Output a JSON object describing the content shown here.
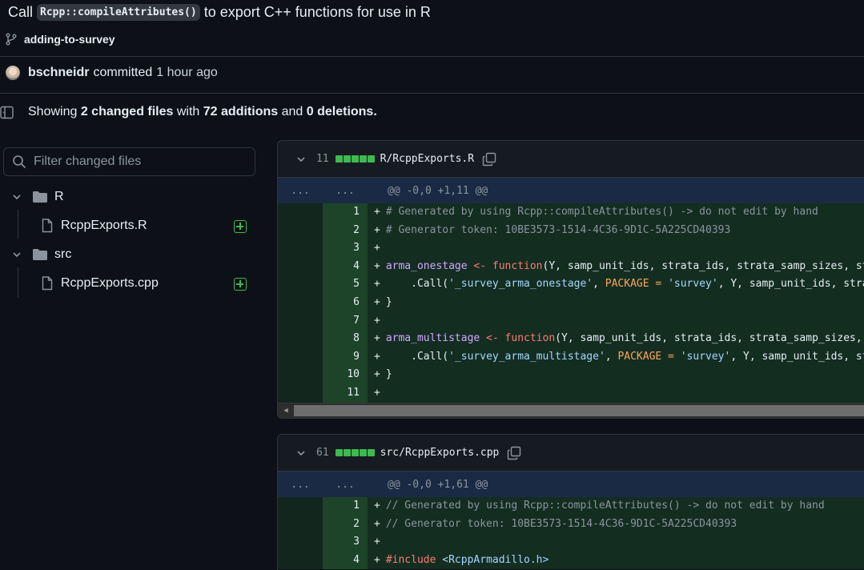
{
  "header": {
    "title_pre": "Call",
    "title_code": "Rcpp::compileAttributes()",
    "title_post": "to export C++ functions for use in R",
    "branch": "adding-to-survey"
  },
  "commit": {
    "author": "bschneidr",
    "action": "committed",
    "time": "1 hour ago"
  },
  "summary": {
    "showing": "Showing",
    "files": "2 changed files",
    "with": "with",
    "additions": "72 additions",
    "and": "and",
    "deletions": "0 deletions",
    "period": "."
  },
  "filter": {
    "placeholder": "Filter changed files"
  },
  "tree": {
    "folder1": "R",
    "file1": "RcppExports.R",
    "folder2": "src",
    "file2": "RcppExports.cpp"
  },
  "diff1": {
    "count": "11",
    "filename": "R/RcppExports.R",
    "hunk_left": "...",
    "hunk_right": "...",
    "hunk_header": "@@ -0,0 +1,11 @@",
    "lines": [
      {
        "n": "1",
        "text": "# Generated by using Rcpp::compileAttributes() -> do not edit by hand"
      },
      {
        "n": "2",
        "text": "# Generator token: 10BE3573-1514-4C36-9D1C-5A225CD40393"
      },
      {
        "n": "3",
        "text": ""
      },
      {
        "n": "4",
        "p1": "arma_onestage",
        "p2": " <- ",
        "p3": "function",
        "p4": "(Y, samp_unit_ids, strata_ids, strata_samp_sizes, strata_pop_sizes) {"
      },
      {
        "n": "5",
        "p1": "    .Call(",
        "p2": "'_survey_arma_onestage'",
        "p3": ", ",
        "p4": "PACKAGE = ",
        "p5": "'survey'",
        "p6": ", Y, samp_unit_ids, strata_ids, strata_samp_sizes, strata_pop_sizes)"
      },
      {
        "n": "6",
        "text": "}"
      },
      {
        "n": "7",
        "text": ""
      },
      {
        "n": "8",
        "p1": "arma_multistage",
        "p2": " <- ",
        "p3": "function",
        "p4": "(Y, samp_unit_ids, strata_ids, strata_samp_sizes, strata_pop_sizes) {"
      },
      {
        "n": "9",
        "p1": "    .Call(",
        "p2": "'_survey_arma_multistage'",
        "p3": ", ",
        "p4": "PACKAGE = ",
        "p5": "'survey'",
        "p6": ", Y, samp_unit_ids, strata_ids, strata_samp_sizes)"
      },
      {
        "n": "10",
        "text": "}"
      },
      {
        "n": "11",
        "text": ""
      }
    ]
  },
  "diff2": {
    "count": "61",
    "filename": "src/RcppExports.cpp",
    "hunk_left": "...",
    "hunk_right": "...",
    "hunk_header": "@@ -0,0 +1,61 @@",
    "lines": [
      {
        "n": "1",
        "text": "// Generated by using Rcpp::compileAttributes() -> do not edit by hand"
      },
      {
        "n": "2",
        "text": "// Generator token: 10BE3573-1514-4C36-9D1C-5A225CD40393"
      },
      {
        "n": "3",
        "text": ""
      },
      {
        "n": "4",
        "p1": "#include",
        "p2": " <RcppArmadillo.h>"
      }
    ]
  },
  "plus_sign": "+"
}
